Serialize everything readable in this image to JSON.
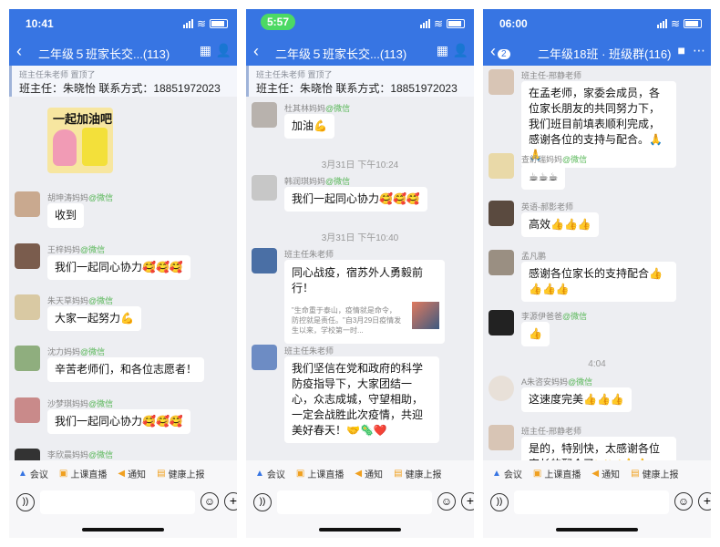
{
  "phones": [
    {
      "status": {
        "time": "10:41"
      },
      "nav": {
        "title": "二年级５班家长交...(113)"
      },
      "pinned": {
        "sub": "班主任朱老师 置顶了",
        "main": "班主任：朱晓怡 联系方式：18851972023"
      },
      "sticker_text": "一起加油吧",
      "messages": [
        {
          "name": "胡坤涛妈妈",
          "source": "@微信",
          "text": "收到"
        },
        {
          "name": "王梓妈妈",
          "source": "@微信",
          "text": "我们一起同心协力🥰🥰🥰"
        },
        {
          "name": "朱天草妈妈",
          "source": "@微信",
          "text": "大家一起努力💪"
        },
        {
          "name": "沈力妈妈",
          "source": "@微信",
          "text": "辛苦老师们，和各位志愿者！"
        },
        {
          "name": "沙梦琪妈妈",
          "source": "@微信",
          "text": "我们一起同心协力🥰🥰🥰"
        },
        {
          "name": "李欣晨妈妈",
          "source": "@微信",
          "text": ""
        }
      ]
    },
    {
      "status": {
        "time": "5:57"
      },
      "nav": {
        "title": "二年级５班家长交...(113)"
      },
      "pinned": {
        "sub": "班主任朱老师 置顶了",
        "main": "班主任：朱晓怡 联系方式：18851972023"
      },
      "messages": [
        {
          "name": "杜其林妈妈",
          "source": "@微信",
          "text": "加油💪"
        },
        {
          "name": "韩润琪妈妈",
          "source": "@微信",
          "text": "我们一起同心协力🥰🥰🥰"
        },
        {
          "name": "班主任朱老师",
          "source": "",
          "text": ""
        },
        {
          "name": "班主任朱老师",
          "source": "",
          "text": "我们坚信在党和政府的科学防疫指导下，大家团结一心，众志成城，守望相助，一定会战胜此次疫情，共迎美好春天！🤝🦠❤️"
        }
      ],
      "timestamps": [
        "3月31日 下午10:24",
        "3月31日 下午10:40"
      ],
      "card": {
        "title": "同心战疫，宿苏外人勇毅前行！",
        "desc": "\"生命重于泰山，疫情就是命令，防控就是责任。\"自3月29日疫情发生以来，学校第一时..."
      }
    },
    {
      "status": {
        "time": "06:00"
      },
      "nav": {
        "title": "二年级18班 · 班级群(116)",
        "back_badge": "2"
      },
      "messages": [
        {
          "name": "班主任-邢静老师",
          "source": "",
          "text": "在孟老师，家委会成员，各位家长朋友的共同努力下，我们班目前填表顺利完成，感谢各位的支持与配合。🙏🙏"
        },
        {
          "name": "查舒瑞妈妈",
          "source": "@微信",
          "text": "☕☕☕"
        },
        {
          "name": "英语-郝影老师",
          "source": "",
          "text": "高效👍👍👍"
        },
        {
          "name": "孟凡鹏",
          "source": "",
          "text": "感谢各位家长的支持配合👍👍👍👍"
        },
        {
          "name": "李源伊爸爸",
          "source": "@微信",
          "text": "👍"
        },
        {
          "name": "A朱咨安妈妈",
          "source": "@微信",
          "text": "这速度完美👍👍👍"
        },
        {
          "name": "班主任-邢静老师",
          "source": "",
          "text": "是的，特别快，太感谢各位家长的配合了🤝🤝👍👍"
        }
      ],
      "timestamps": [
        "4:04"
      ]
    }
  ],
  "toolbar": {
    "meeting": "会议",
    "live": "上课直播",
    "notice": "通知",
    "health": "健康上报"
  },
  "icons": [
    "back-arrow-icon",
    "qr-code-icon",
    "contact-icon",
    "video-icon",
    "more-icon",
    "voice-icon",
    "emoji-icon",
    "plus-icon"
  ],
  "colors": {
    "header": "#3775e3",
    "bg": "#edeef2",
    "wechat_tag": "#5ab85a"
  }
}
